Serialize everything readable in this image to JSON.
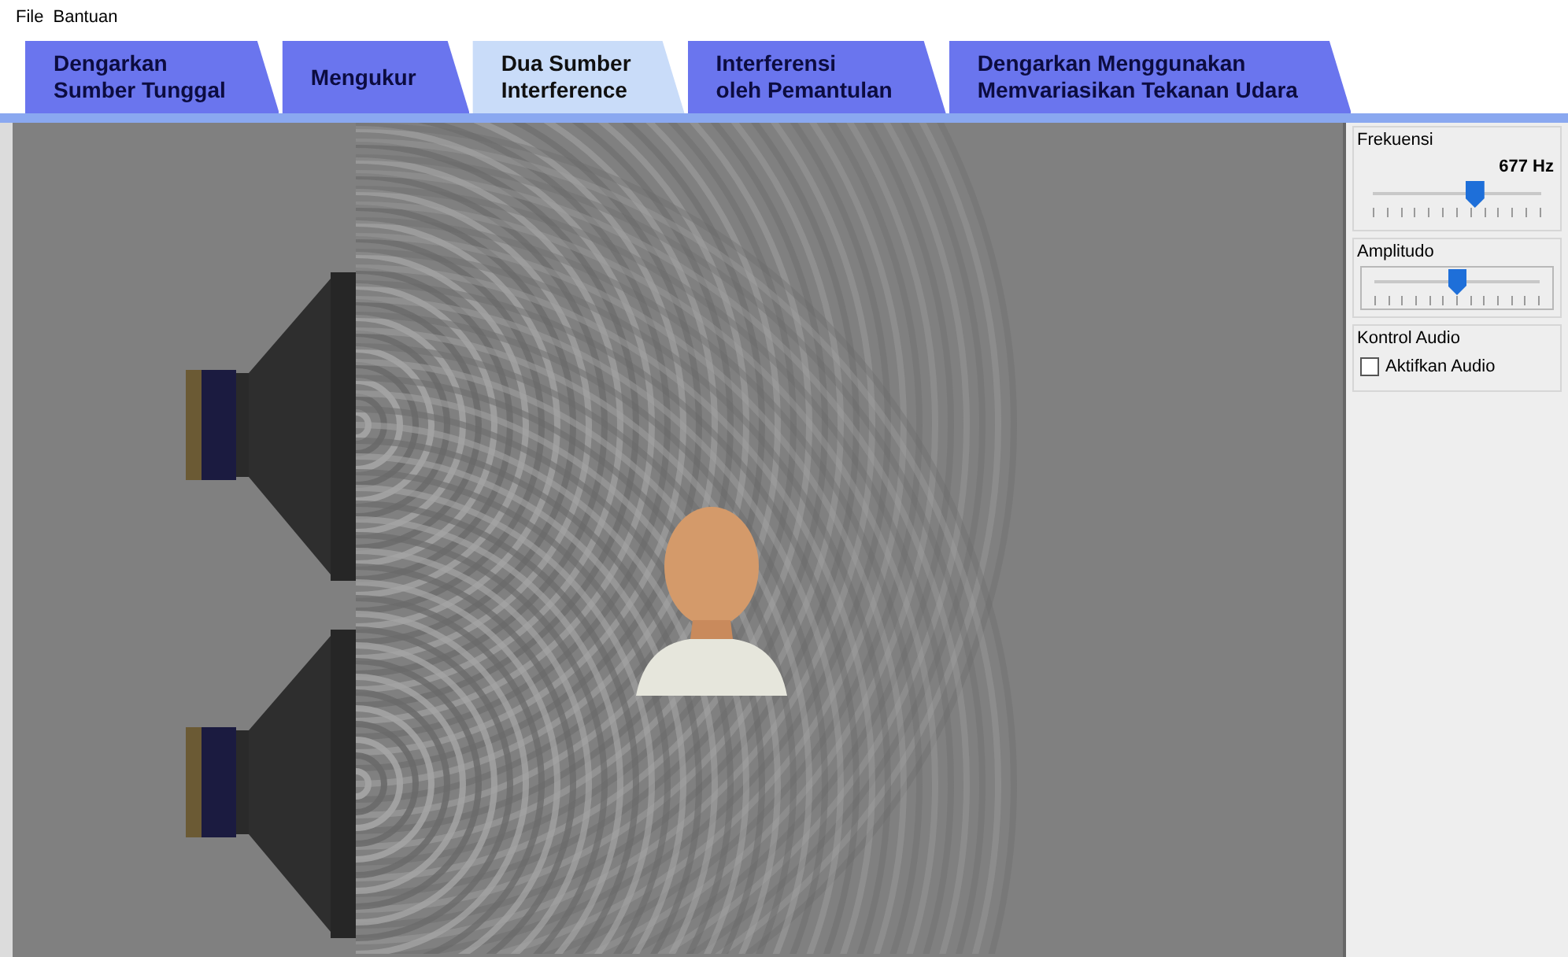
{
  "menu": [
    "File",
    "Bantuan"
  ],
  "tabs": [
    {
      "label": "Dengarkan\nSumber Tunggal",
      "selected": false
    },
    {
      "label": "Mengukur",
      "selected": false
    },
    {
      "label": "Dua Sumber\nInterference",
      "selected": true
    },
    {
      "label": "Interferensi\noleh Pemantulan",
      "selected": false
    },
    {
      "label": "Dengarkan Menggunakan\nMemvariasikan Tekanan Udara",
      "selected": false
    }
  ],
  "controls": {
    "frequency": {
      "title": "Frekuensi",
      "reading": "677 Hz",
      "level": 0.62
    },
    "amplitude": {
      "title": "Amplitudo",
      "level": 0.5
    },
    "audio": {
      "title": "Kontrol Audio",
      "label": "Aktifkan Audio",
      "checked": false
    }
  }
}
